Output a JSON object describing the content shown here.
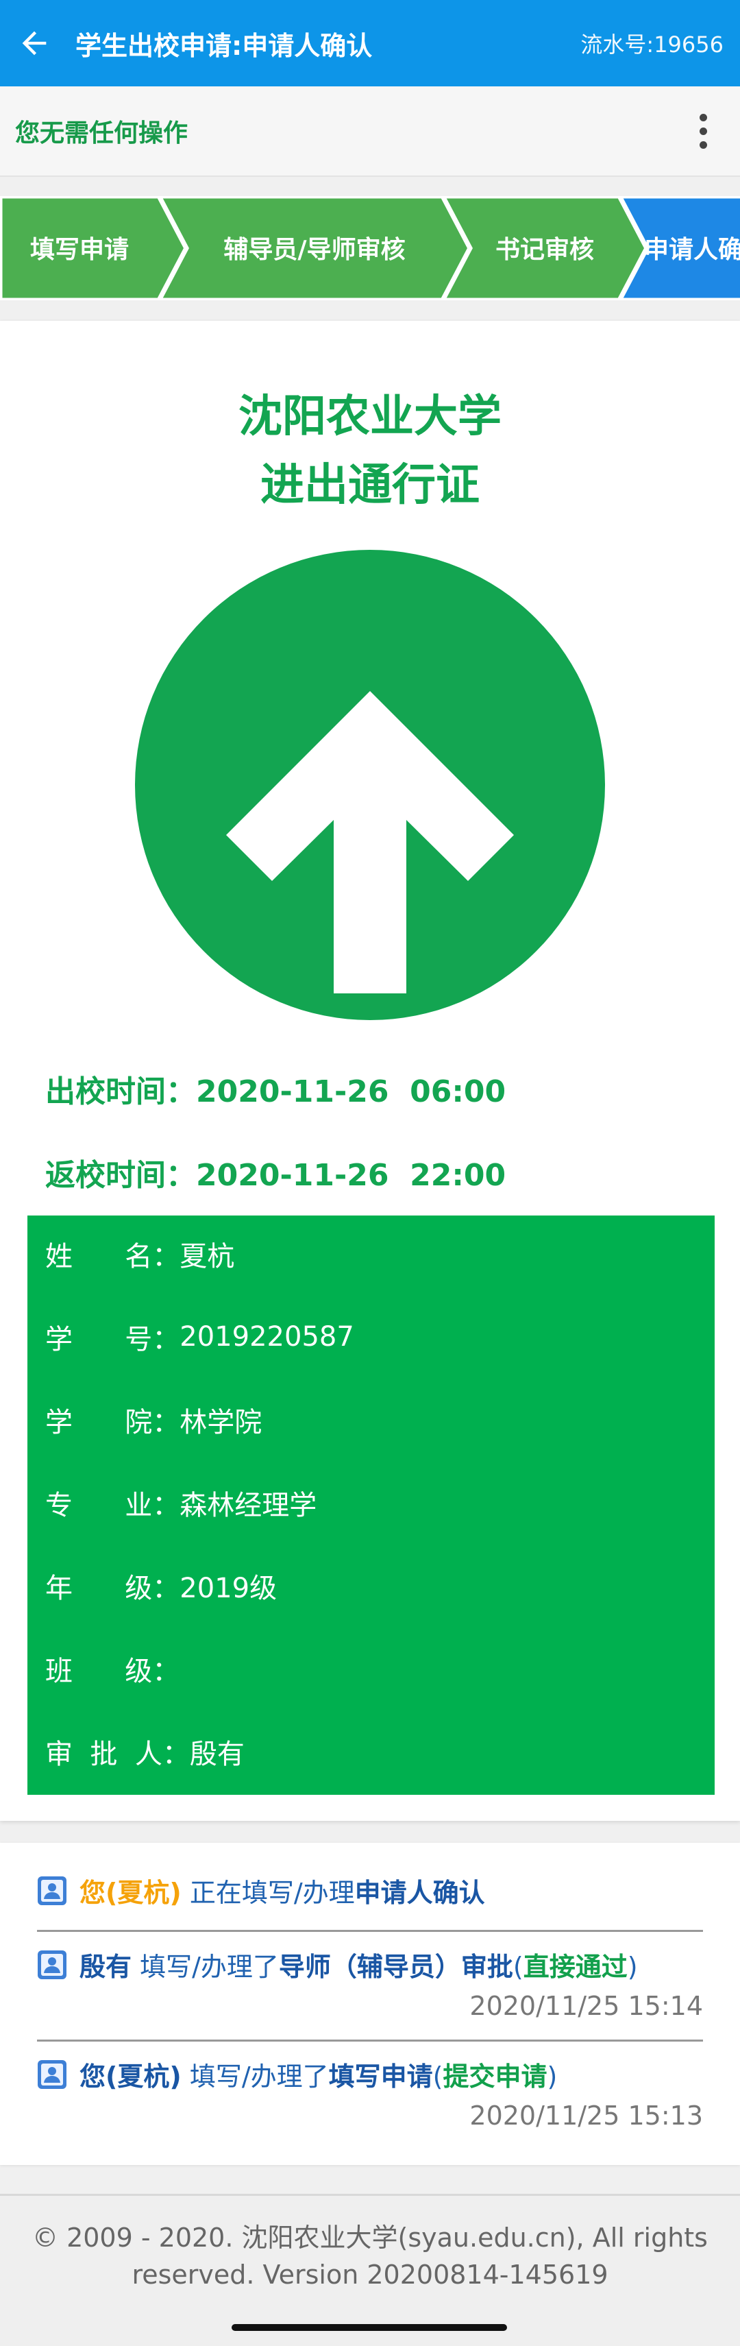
{
  "appbar": {
    "title": "学生出校申请:申请人确认",
    "serial": "流水号:19656"
  },
  "status": {
    "message": "您无需任何操作"
  },
  "steps": {
    "items": [
      "填写申请",
      "辅导员/导师审核",
      "书记审核",
      "申请人确"
    ],
    "colors": {
      "done": "#4caf50",
      "active": "#1e88e5"
    }
  },
  "pass": {
    "university": "沈阳农业大学",
    "title": "进出通行证",
    "out_time_label": "出校时间：",
    "out_time": "2020-11-26  06:00",
    "back_time_label": "返校时间：",
    "back_time": "2020-11-26  22:00",
    "color": "#13a551"
  },
  "info": {
    "rows": [
      {
        "label": "姓      名：",
        "value": "夏杭"
      },
      {
        "label": "学      号：",
        "value": "2019220587"
      },
      {
        "label": "学      院：",
        "value": "林学院"
      },
      {
        "label": "专      业：",
        "value": "森林经理学"
      },
      {
        "label": "年      级：",
        "value": "2019级"
      },
      {
        "label": "班      级：",
        "value": ""
      },
      {
        "label": "审  批  人：",
        "value": "殷有"
      }
    ]
  },
  "timeline": {
    "items": [
      {
        "actor": "您(夏杭)",
        "action": " 正在填写/办理",
        "step": "申请人确认",
        "result": "",
        "date": ""
      },
      {
        "actor": "殷有",
        "action": " 填写/办理了",
        "step": "导师（辅导员）审批",
        "result": "直接通过",
        "date": "2020/11/25 15:14"
      },
      {
        "actor": "您(夏杭)",
        "action": " 填写/办理了",
        "step": "填写申请",
        "result": "提交申请",
        "date": "2020/11/25 15:13"
      }
    ]
  },
  "footer": {
    "line1": "© 2009 - 2020. 沈阳农业大学(syau.edu.cn), All rights",
    "line2": "reserved. Version 20200814-145619"
  },
  "icons": {
    "back": "arrow-left-icon",
    "more": "more-vertical-icon",
    "direction": "arrow-up-icon",
    "user": "user-icon"
  }
}
